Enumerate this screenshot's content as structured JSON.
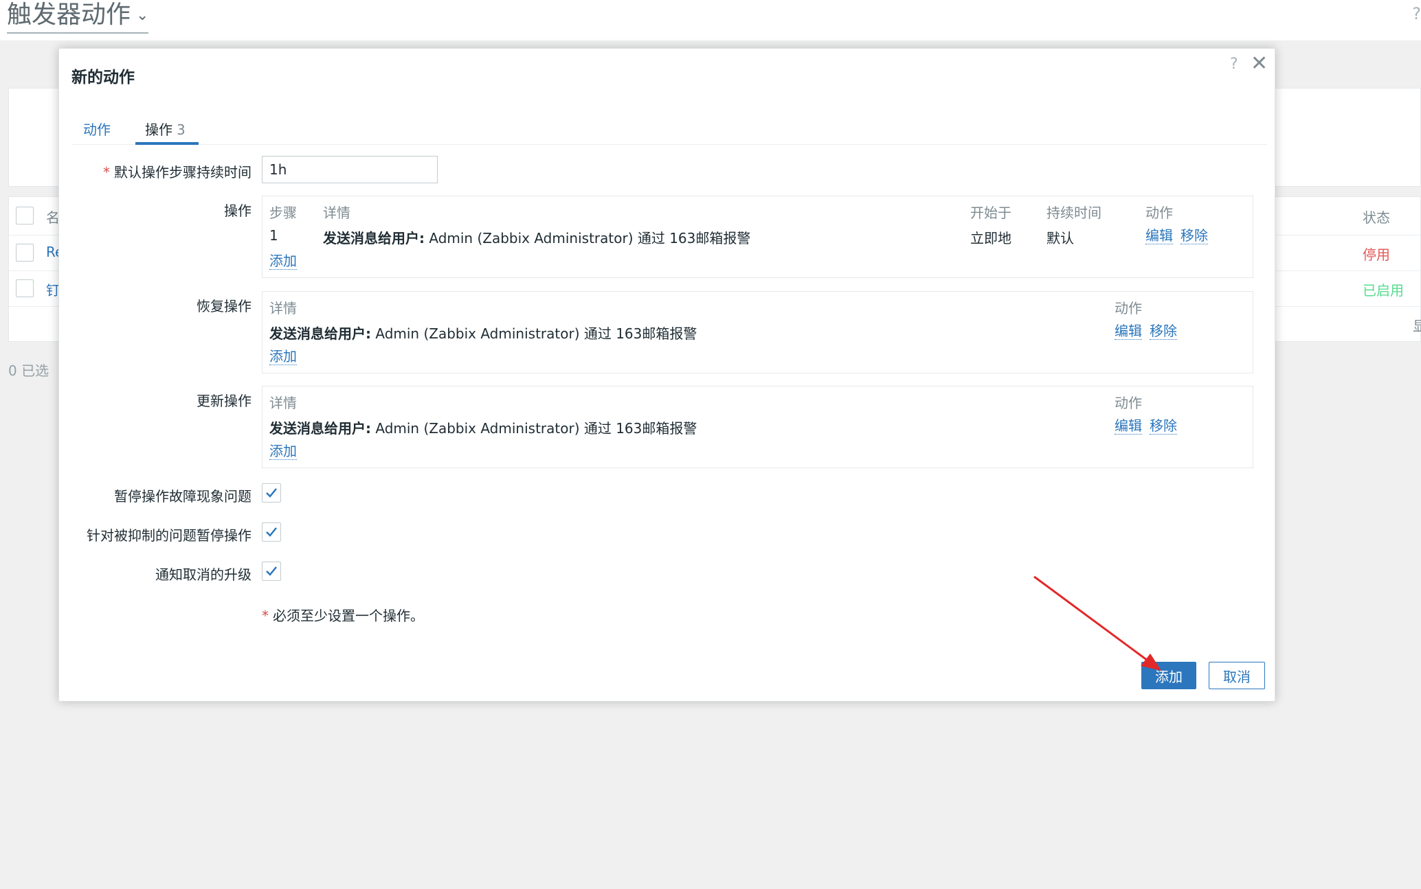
{
  "page": {
    "title": "触发器动作",
    "help": "?"
  },
  "list": {
    "header_name": "名",
    "header_status": "状态",
    "rows": [
      {
        "name": "Re",
        "status": "停用",
        "status_color": "#e45959"
      },
      {
        "name": "钉",
        "status": "已启用",
        "status_color": "#59db8f"
      }
    ],
    "row_side_text": "显",
    "selected_count": "0 已选"
  },
  "modal": {
    "title": "新的动作",
    "help": "?",
    "close": "✕",
    "tabs": [
      {
        "label": "动作"
      },
      {
        "label": "操作",
        "badge": "3"
      }
    ],
    "step_duration_label": "默认操作步骤持续时间",
    "step_duration_value": "1h",
    "operations": {
      "label": "操作",
      "headers": {
        "step": "步骤",
        "details": "详情",
        "start": "开始于",
        "duration": "持续时间",
        "action": "动作"
      },
      "row": {
        "step": "1",
        "details_bold": "发送消息给用户:",
        "details_text": " Admin (Zabbix Administrator) 通过 163邮箱报警",
        "start": "立即地",
        "duration": "默认",
        "edit": "编辑",
        "remove": "移除"
      },
      "add": "添加"
    },
    "recovery": {
      "label": "恢复操作",
      "headers": {
        "details": "详情",
        "action": "动作"
      },
      "row": {
        "details_bold": "发送消息给用户:",
        "details_text": " Admin (Zabbix Administrator) 通过 163邮箱报警",
        "edit": "编辑",
        "remove": "移除"
      },
      "add": "添加"
    },
    "update": {
      "label": "更新操作",
      "headers": {
        "details": "详情",
        "action": "动作"
      },
      "row": {
        "details_bold": "发送消息给用户:",
        "details_text": " Admin (Zabbix Administrator) 通过 163邮箱报警",
        "edit": "编辑",
        "remove": "移除"
      },
      "add": "添加"
    },
    "checkboxes": [
      {
        "label": "暂停操作故障现象问题",
        "checked": true
      },
      {
        "label": "针对被抑制的问题暂停操作",
        "checked": true
      },
      {
        "label": "通知取消的升级",
        "checked": true
      }
    ],
    "note": "必须至少设置一个操作。",
    "required_mark": "*",
    "buttons": {
      "add": "添加",
      "cancel": "取消"
    }
  },
  "colors": {
    "accent": "#2b76bc",
    "required": "#d64e4e",
    "annotation_arrow": "#e32828"
  }
}
